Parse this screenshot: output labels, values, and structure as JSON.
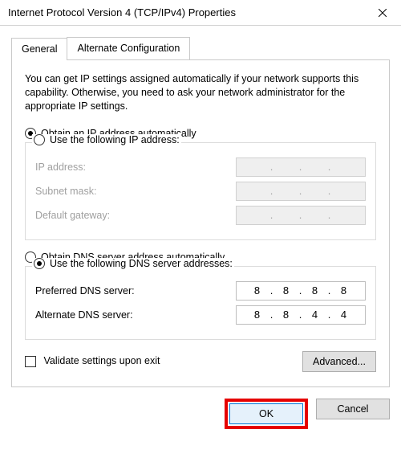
{
  "window": {
    "title": "Internet Protocol Version 4 (TCP/IPv4) Properties"
  },
  "tabs": {
    "general": "General",
    "alternate": "Alternate Configuration"
  },
  "description": "You can get IP settings assigned automatically if your network supports this capability. Otherwise, you need to ask your network administrator for the appropriate IP settings.",
  "ip": {
    "auto_label": "Obtain an IP address automatically",
    "manual_label": "Use the following IP address:",
    "auto_selected": true,
    "address_label": "IP address:",
    "subnet_label": "Subnet mask:",
    "gateway_label": "Default gateway:",
    "address": [
      "",
      "",
      "",
      ""
    ],
    "subnet": [
      "",
      "",
      "",
      ""
    ],
    "gateway": [
      "",
      "",
      "",
      ""
    ]
  },
  "dns": {
    "auto_label": "Obtain DNS server address automatically",
    "manual_label": "Use the following DNS server addresses:",
    "manual_selected": true,
    "preferred_label": "Preferred DNS server:",
    "alternate_label": "Alternate DNS server:",
    "preferred": [
      "8",
      "8",
      "8",
      "8"
    ],
    "alternate": [
      "8",
      "8",
      "4",
      "4"
    ]
  },
  "validate_label": "Validate settings upon exit",
  "buttons": {
    "advanced": "Advanced...",
    "ok": "OK",
    "cancel": "Cancel"
  }
}
